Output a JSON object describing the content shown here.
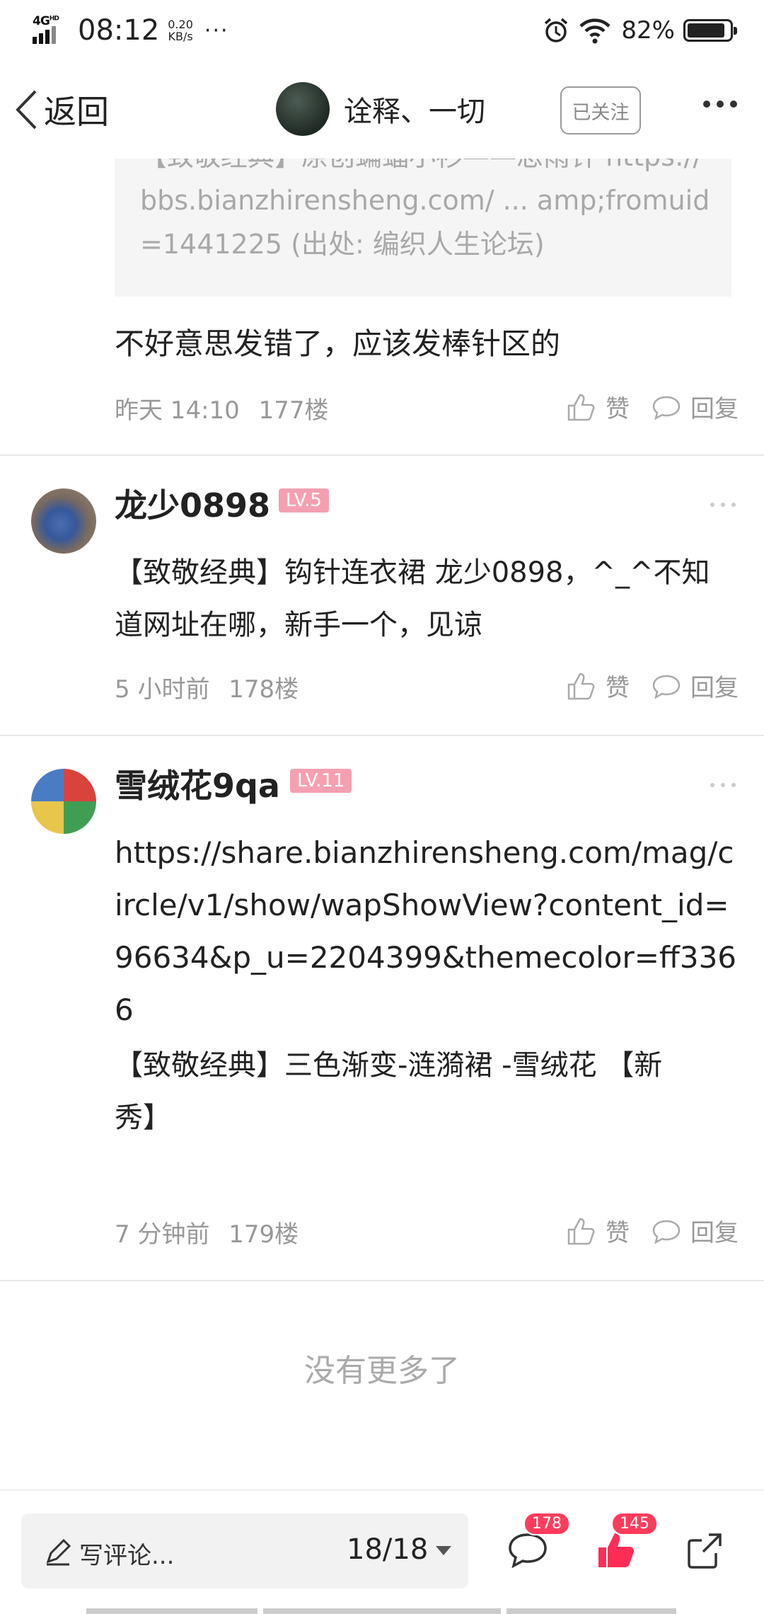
{
  "status_bar": {
    "network": "4G",
    "network_sup": "HD",
    "time": "08:12",
    "speed_value": "0.20",
    "speed_unit": "KB/s",
    "overflow": "···",
    "battery": "82%",
    "battery_level": 0.82
  },
  "nav": {
    "back_label": "返回",
    "username": "诠释、一切",
    "follow_label": "已关注"
  },
  "quote": {
    "text": "【致敬经典】原创蝙蝠小衫——忠雨针 https://bbs.bianzhirensheng.com/ ... amp;fromuid=1441225 (出处: 编织人生论坛)"
  },
  "floor_177": {
    "text": "不好意思发错了，应该发棒针区的",
    "time": "昨天 14:10",
    "floor": "177楼",
    "like_label": "赞",
    "reply_label": "回复"
  },
  "floor_178": {
    "username": "龙少0898",
    "level": "LV.5",
    "text": "【致敬经典】钩针连衣裙  龙少0898，^_^不知道网址在哪，新手一个，见谅",
    "time": "5 小时前",
    "floor": "178楼",
    "like_label": "赞",
    "reply_label": "回复"
  },
  "floor_179": {
    "username": "雪绒花9qa",
    "level": "LV.11",
    "url": "https://share.bianzhirensheng.com/mag/circle/v1/show/wapShowView?content_id=96634&p_u=2204399&themecolor=ff3366",
    "text": "【致敬经典】三色渐变-涟漪裙 -雪绒花  【新秀】",
    "time": "7 分钟前",
    "floor": "179楼",
    "like_label": "赞",
    "reply_label": "回复"
  },
  "no_more": "没有更多了",
  "bottom": {
    "comment_placeholder": "写评论...",
    "page": "18/18",
    "comment_count": "178",
    "like_count": "145"
  },
  "colors": {
    "accent": "#ff3366",
    "badge": "#ff3c5c",
    "level_badge": "#f4a0b0"
  }
}
